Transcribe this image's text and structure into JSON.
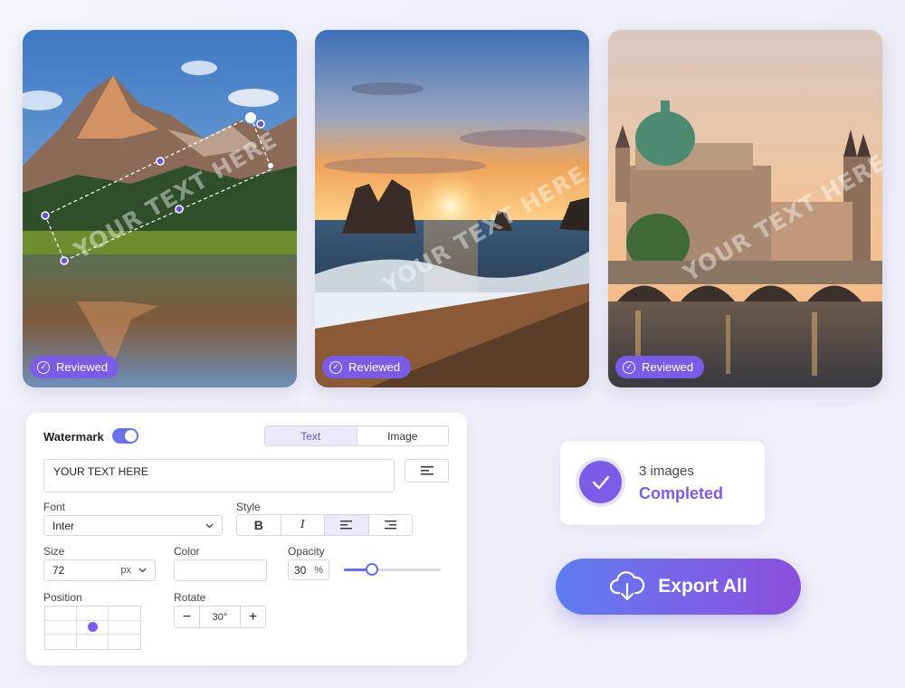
{
  "cards": [
    {
      "watermark": "YOUR TEXT HERE",
      "badge": "Reviewed"
    },
    {
      "watermark": "YOUR TEXT HERE",
      "badge": "Reviewed"
    },
    {
      "watermark": "YOUR TEXT HERE",
      "badge": "Reviewed"
    }
  ],
  "panel": {
    "watermark_label": "Watermark",
    "watermark_enabled": true,
    "tabs": [
      "Text",
      "Image"
    ],
    "active_tab": "Text",
    "text_value": "YOUR TEXT HERE",
    "font_label": "Font",
    "font_value": "Inter",
    "style_label": "Style",
    "style_buttons": [
      "B",
      "I"
    ],
    "size_label": "Size",
    "size_value": "72",
    "size_unit": "px",
    "color_label": "Color",
    "opacity_label": "Opacity",
    "opacity_value": "30",
    "opacity_unit": "%",
    "opacity_level": 0.3,
    "position_label": "Position",
    "position_selected": "center",
    "rotate_label": "Rotate",
    "rotate_value": "30°",
    "rotate_minus": "−",
    "rotate_plus": "+"
  },
  "status": {
    "count_text": "3 images",
    "state_text": "Completed"
  },
  "export": {
    "label": "Export All"
  },
  "colors": {
    "accent": "#7b5ce6",
    "toggle": "#6b72e8",
    "export_start": "#5f7df0",
    "export_end": "#8a4fdc"
  },
  "icons": [
    "check-circle-icon",
    "align-left-icon",
    "align-right-icon",
    "chevron-down-icon",
    "checkmark-icon",
    "cloud-download-icon",
    "plus-icon",
    "minus-icon"
  ]
}
